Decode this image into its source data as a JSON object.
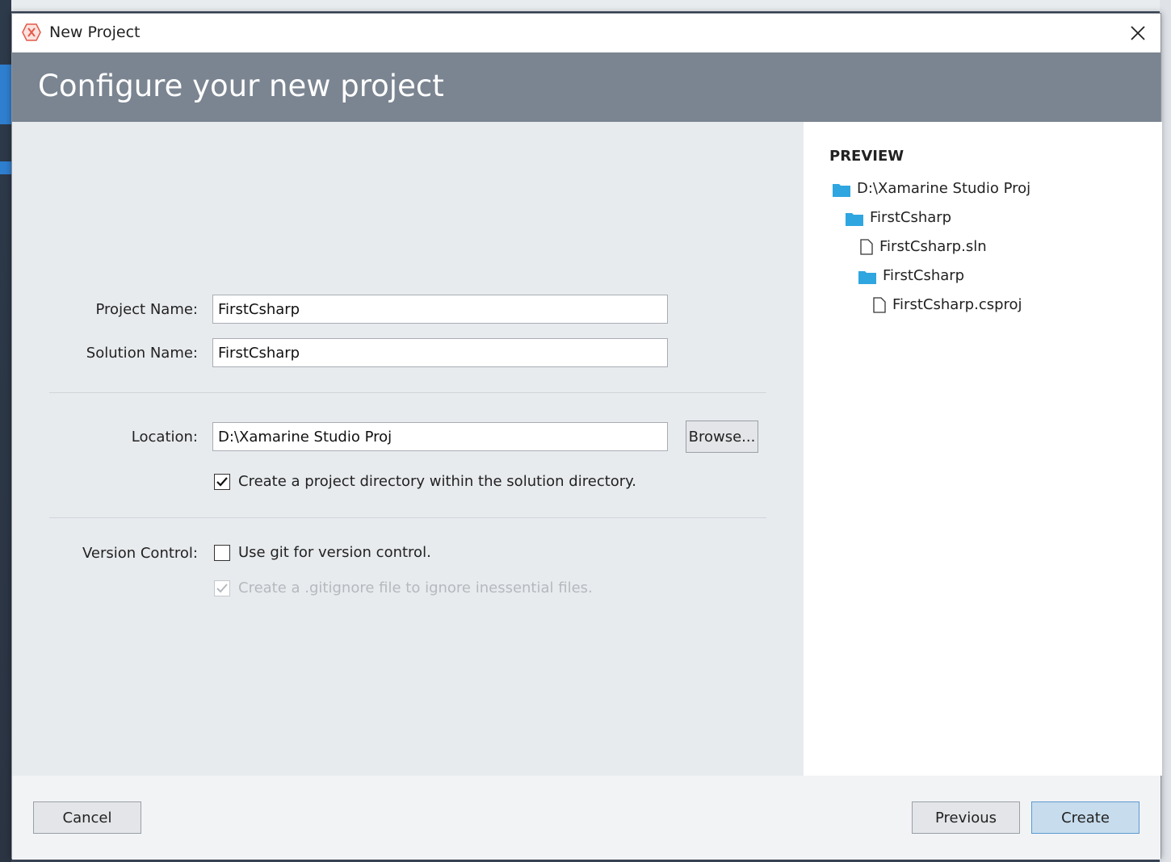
{
  "window": {
    "title": "New Project",
    "close_icon": "close-icon",
    "app_icon": "xamarin-logo-icon"
  },
  "header": {
    "title": "Configure your new project"
  },
  "form": {
    "project_name_label": "Project Name:",
    "project_name_value": "FirstCsharp",
    "solution_name_label": "Solution Name:",
    "solution_name_value": "FirstCsharp",
    "location_label": "Location:",
    "location_value": "D:\\Xamarine Studio Proj",
    "browse_label": "Browse...",
    "create_dir_label": "Create a project directory within the solution directory.",
    "create_dir_checked": true,
    "version_control_label": "Version Control:",
    "use_git_label": "Use git for version control.",
    "use_git_checked": false,
    "gitignore_label": "Create a .gitignore file to ignore inessential files.",
    "gitignore_checked": true,
    "gitignore_disabled": true
  },
  "preview": {
    "title": "PREVIEW",
    "items": [
      {
        "label": "D:\\Xamarine Studio Proj",
        "type": "folder",
        "depth": 0
      },
      {
        "label": "FirstCsharp",
        "type": "folder",
        "depth": 1
      },
      {
        "label": "FirstCsharp.sln",
        "type": "file",
        "depth": 2
      },
      {
        "label": "FirstCsharp",
        "type": "folder",
        "depth": 2
      },
      {
        "label": "FirstCsharp.csproj",
        "type": "file",
        "depth": 3
      }
    ]
  },
  "footer": {
    "cancel_label": "Cancel",
    "previous_label": "Previous",
    "create_label": "Create"
  },
  "colors": {
    "header_band": "#7b8591",
    "folder": "#2fa6e0",
    "primary_button": "#c7dced"
  }
}
